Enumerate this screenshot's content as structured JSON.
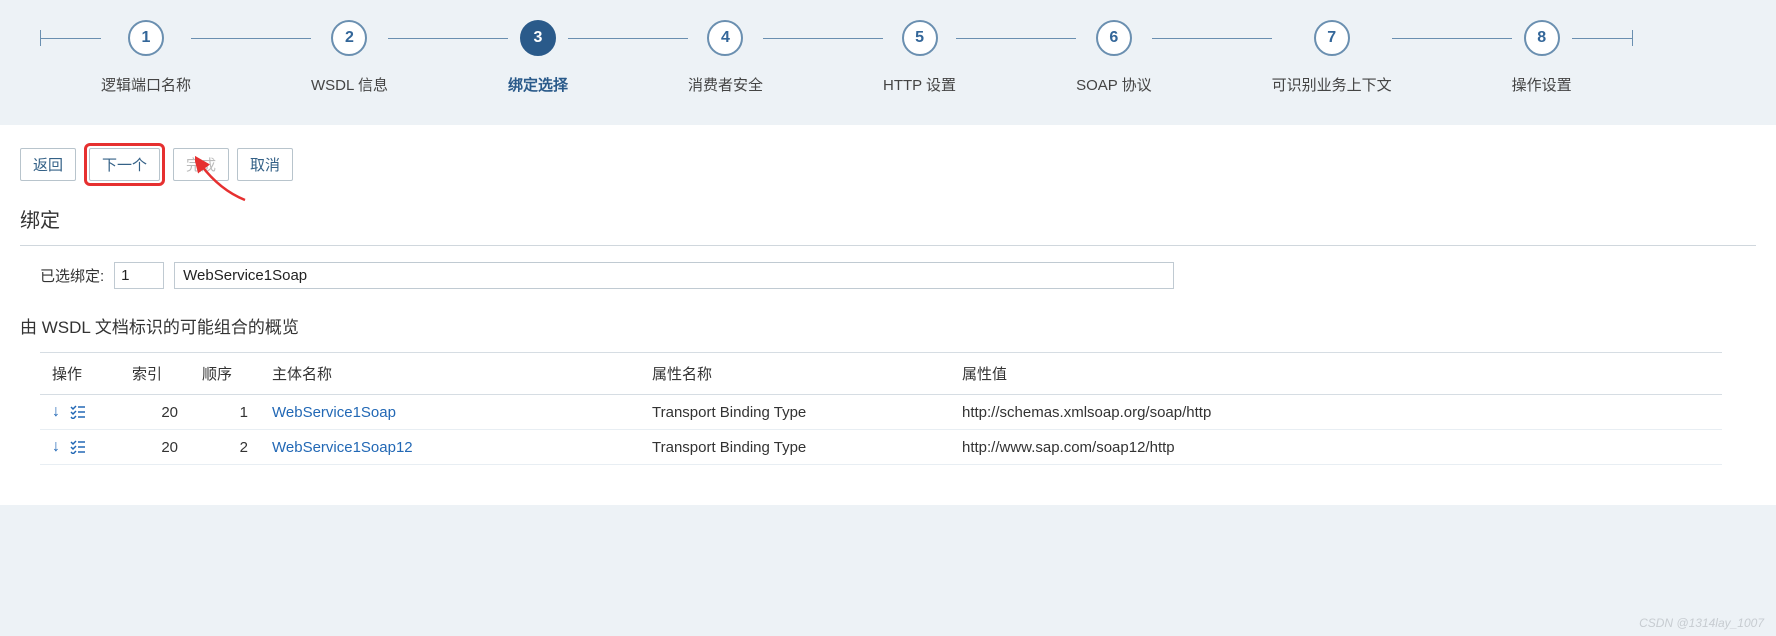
{
  "steps": [
    {
      "num": "1",
      "label": "逻辑端口名称",
      "active": false
    },
    {
      "num": "2",
      "label": "WSDL 信息",
      "active": false
    },
    {
      "num": "3",
      "label": "绑定选择",
      "active": true
    },
    {
      "num": "4",
      "label": "消费者安全",
      "active": false
    },
    {
      "num": "5",
      "label": "HTTP 设置",
      "active": false
    },
    {
      "num": "6",
      "label": "SOAP 协议",
      "active": false
    },
    {
      "num": "7",
      "label": "可识别业务上下文",
      "active": false
    },
    {
      "num": "8",
      "label": "操作设置",
      "active": false
    }
  ],
  "buttons": {
    "back": "返回",
    "next": "下一个",
    "finish": "完成",
    "cancel": "取消"
  },
  "section": {
    "binding_title": "绑定",
    "selected_label": "已选绑定:",
    "selected_count": "1",
    "selected_name": "WebService1Soap",
    "overview_title": "由 WSDL 文档标识的可能组合的概览"
  },
  "table": {
    "headers": {
      "action": "操作",
      "index": "索引",
      "order": "顺序",
      "subject": "主体名称",
      "attr_name": "属性名称",
      "attr_value": "属性值"
    },
    "rows": [
      {
        "index": "20",
        "order": "1",
        "subject": "WebService1Soap",
        "attr_name": "Transport Binding Type",
        "attr_value": "http://schemas.xmlsoap.org/soap/http"
      },
      {
        "index": "20",
        "order": "2",
        "subject": "WebService1Soap12",
        "attr_name": "Transport Binding Type",
        "attr_value": "http://www.sap.com/soap12/http"
      }
    ]
  },
  "watermark": "CSDN @1314lay_1007"
}
